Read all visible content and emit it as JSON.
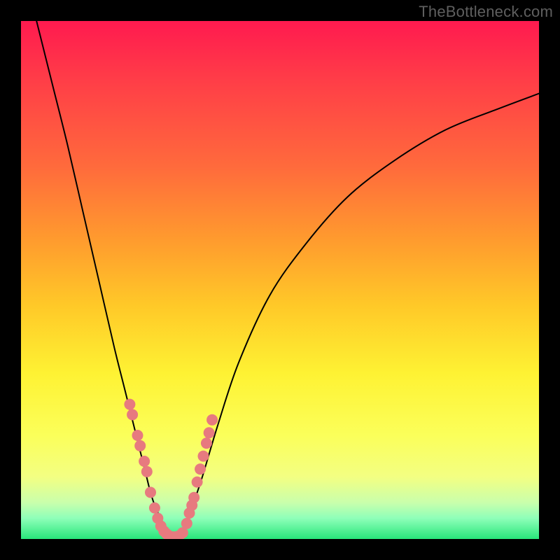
{
  "watermark": "TheBottleneck.com",
  "colors": {
    "frame": "#000000",
    "curve_stroke": "#000000",
    "marker_fill": "#e77a7f",
    "marker_stroke": "#6b1f1f",
    "gradient_top": "#ff1a4f",
    "gradient_bottom": "#28e67a"
  },
  "chart_data": {
    "type": "line",
    "title": "",
    "subtitle": "",
    "xlabel": "",
    "ylabel": "",
    "xlim": [
      0,
      100
    ],
    "ylim": [
      0,
      100
    ],
    "grid": false,
    "legend": false,
    "annotations": [],
    "series": [
      {
        "name": "bottleneck-curve-left",
        "x": [
          3,
          6,
          9,
          12,
          15,
          18,
          20,
          22,
          24,
          25,
          26,
          27,
          28,
          29,
          30
        ],
        "y": [
          100,
          88,
          76,
          63,
          50,
          37,
          29,
          21,
          13,
          9,
          6,
          4,
          2,
          1,
          0
        ]
      },
      {
        "name": "bottleneck-curve-right",
        "x": [
          30,
          31,
          32,
          33,
          35,
          38,
          42,
          48,
          55,
          63,
          72,
          82,
          92,
          100
        ],
        "y": [
          0,
          1,
          3,
          6,
          12,
          22,
          34,
          47,
          57,
          66,
          73,
          79,
          83,
          86
        ]
      }
    ],
    "markers": {
      "name": "highlighted-points",
      "description": "dense marker cluster on lower V region",
      "x": [
        21.0,
        21.5,
        22.5,
        23.0,
        23.8,
        24.3,
        25.0,
        25.8,
        26.4,
        27.0,
        27.6,
        28.1,
        28.6,
        29.2,
        29.8,
        30.5,
        31.2,
        32.0,
        32.5,
        33.0,
        33.4,
        34.0,
        34.6,
        35.2,
        35.8,
        36.3,
        36.9
      ],
      "y": [
        26.0,
        24.0,
        20.0,
        18.0,
        15.0,
        13.0,
        9.0,
        6.0,
        4.0,
        2.5,
        1.5,
        1.0,
        0.6,
        0.4,
        0.4,
        0.6,
        1.2,
        3.0,
        5.0,
        6.5,
        8.0,
        11.0,
        13.5,
        16.0,
        18.5,
        20.5,
        23.0
      ]
    }
  }
}
